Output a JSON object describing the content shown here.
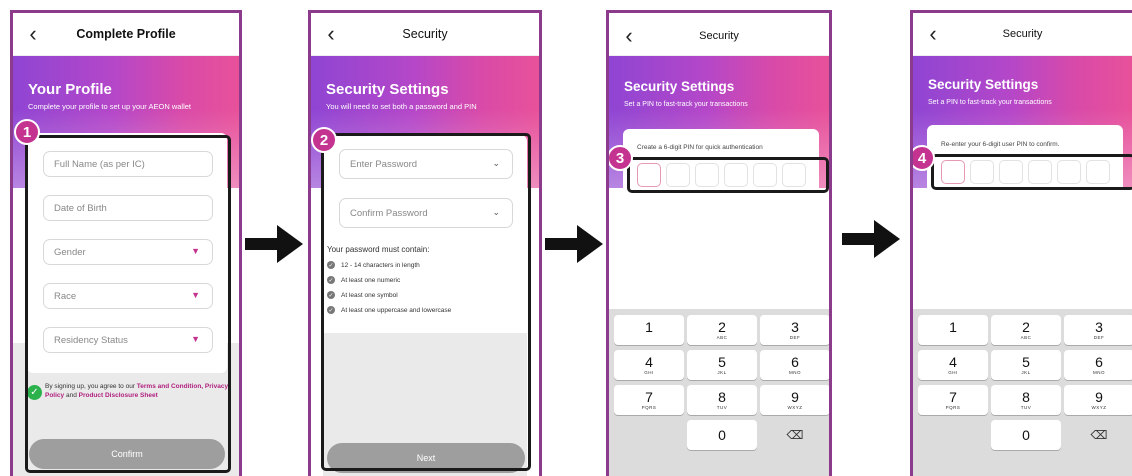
{
  "screen1": {
    "title": "Complete Profile",
    "hero_title": "Your Profile",
    "hero_subtitle": "Complete your profile to set up your AEON wallet",
    "step": "1",
    "fields": [
      {
        "placeholder": "Full Name (as per IC)",
        "dropdown": false
      },
      {
        "placeholder": "Date of Birth",
        "dropdown": false
      },
      {
        "placeholder": "Gender",
        "dropdown": true
      },
      {
        "placeholder": "Race",
        "dropdown": true
      },
      {
        "placeholder": "Residency Status",
        "dropdown": true
      }
    ],
    "consent": {
      "prefix": "By signing up, you agree to our ",
      "terms": "Terms and Condition,",
      "privacy": "Privacy Policy",
      "and": " and ",
      "pds": "Product Disclosure Sheet"
    },
    "confirm_label": "Confirm"
  },
  "screen2": {
    "title": "Security",
    "hero_title": "Security Settings",
    "hero_subtitle": "You will need to set both a password and PIN",
    "step": "2",
    "password_placeholder": "Enter Password",
    "confirm_password_placeholder": "Confirm Password",
    "rules_title": "Your password must contain:",
    "rules": [
      "12 - 14 characters in length",
      "At least one numeric",
      "At least one symbol",
      "At least one uppercase and lowercase"
    ],
    "next_label": "Next"
  },
  "screen3": {
    "title": "Security",
    "hero_title": "Security Settings",
    "hero_subtitle": "Set a PIN to fast-track your transactions",
    "step": "3",
    "pin_prompt": "Create a 6-digit PIN for quick authentication"
  },
  "screen4": {
    "title": "Security",
    "hero_title": "Security Settings",
    "hero_subtitle": "Set a PIN to fast-track your transactions",
    "step": "4",
    "pin_prompt": "Re-enter your 6-digit user PIN to confirm."
  },
  "keypad": [
    {
      "num": "1",
      "letters": ""
    },
    {
      "num": "2",
      "letters": "ABC"
    },
    {
      "num": "3",
      "letters": "DEF"
    },
    {
      "num": "4",
      "letters": "GHI"
    },
    {
      "num": "5",
      "letters": "JKL"
    },
    {
      "num": "6",
      "letters": "MNO"
    },
    {
      "num": "7",
      "letters": "PQRS"
    },
    {
      "num": "8",
      "letters": "TUV"
    },
    {
      "num": "9",
      "letters": "WXYZ"
    },
    {
      "num": "0",
      "letters": ""
    }
  ],
  "icons": {
    "back": "chevron-left-icon",
    "dropdown": "chevron-down-icon",
    "check": "check-circle-icon",
    "delete": "backspace-icon",
    "flow_arrow": "arrow-right-icon"
  },
  "colors": {
    "frame": "#8c3a8c",
    "accent": "#c53391",
    "gradient_start": "#8f45d3",
    "gradient_end": "#e8519a",
    "button_disabled": "#9e9e9e",
    "consent_check": "#2bb24c"
  }
}
